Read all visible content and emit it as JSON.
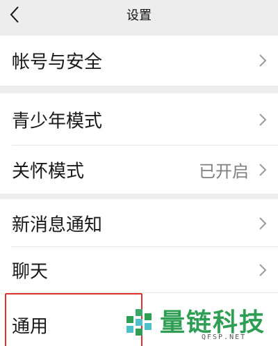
{
  "nav": {
    "title": "设置"
  },
  "groups": [
    {
      "items": [
        {
          "label": "帐号与安全",
          "value": ""
        }
      ]
    },
    {
      "items": [
        {
          "label": "青少年模式",
          "value": ""
        },
        {
          "label": "关怀模式",
          "value": "已开启"
        }
      ]
    },
    {
      "items": [
        {
          "label": "新消息通知",
          "value": ""
        },
        {
          "label": "聊天",
          "value": ""
        },
        {
          "label": "通用",
          "value": ""
        }
      ]
    }
  ],
  "watermark": {
    "text": "量链科技",
    "sub": "QFSP.NET"
  },
  "colors": {
    "background": "#ededed",
    "row": "#ffffff",
    "highlight": "#e0322f",
    "watermark": "#2f9e55"
  }
}
